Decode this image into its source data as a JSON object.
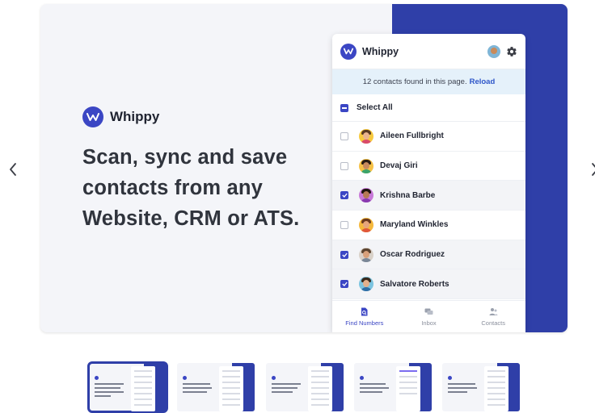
{
  "carousel": {
    "prev_label": "previous slide",
    "next_label": "next slide"
  },
  "slide": {
    "brand_name": "Whippy",
    "headline": "Scan, sync and save contacts from any Website, CRM or ATS."
  },
  "panel": {
    "title": "Whippy",
    "notice_text": "12 contacts found in this page.",
    "notice_link": "Reload",
    "select_all": "Select All",
    "contacts": [
      {
        "name": "Aileen Fullbright",
        "selected": false
      },
      {
        "name": "Devaj Giri",
        "selected": false
      },
      {
        "name": "Krishna Barbe",
        "selected": true
      },
      {
        "name": "Maryland Winkles",
        "selected": false
      },
      {
        "name": "Oscar Rodriguez",
        "selected": true
      },
      {
        "name": "Salvatore Roberts",
        "selected": true
      }
    ],
    "tabs": [
      {
        "label": "Find Numbers",
        "icon": "find-numbers-icon",
        "active": true
      },
      {
        "label": "Inbox",
        "icon": "inbox-icon",
        "active": false
      },
      {
        "label": "Contacts",
        "icon": "contacts-icon",
        "active": false
      }
    ]
  },
  "thumbnails": [
    {
      "active": true
    },
    {
      "active": false
    },
    {
      "active": false
    },
    {
      "active": false
    },
    {
      "active": false
    }
  ],
  "colors": {
    "accent": "#2f3fa8",
    "brand": "#3b46c4",
    "link": "#2d55c8",
    "notice_bg": "#e5f1fa"
  }
}
